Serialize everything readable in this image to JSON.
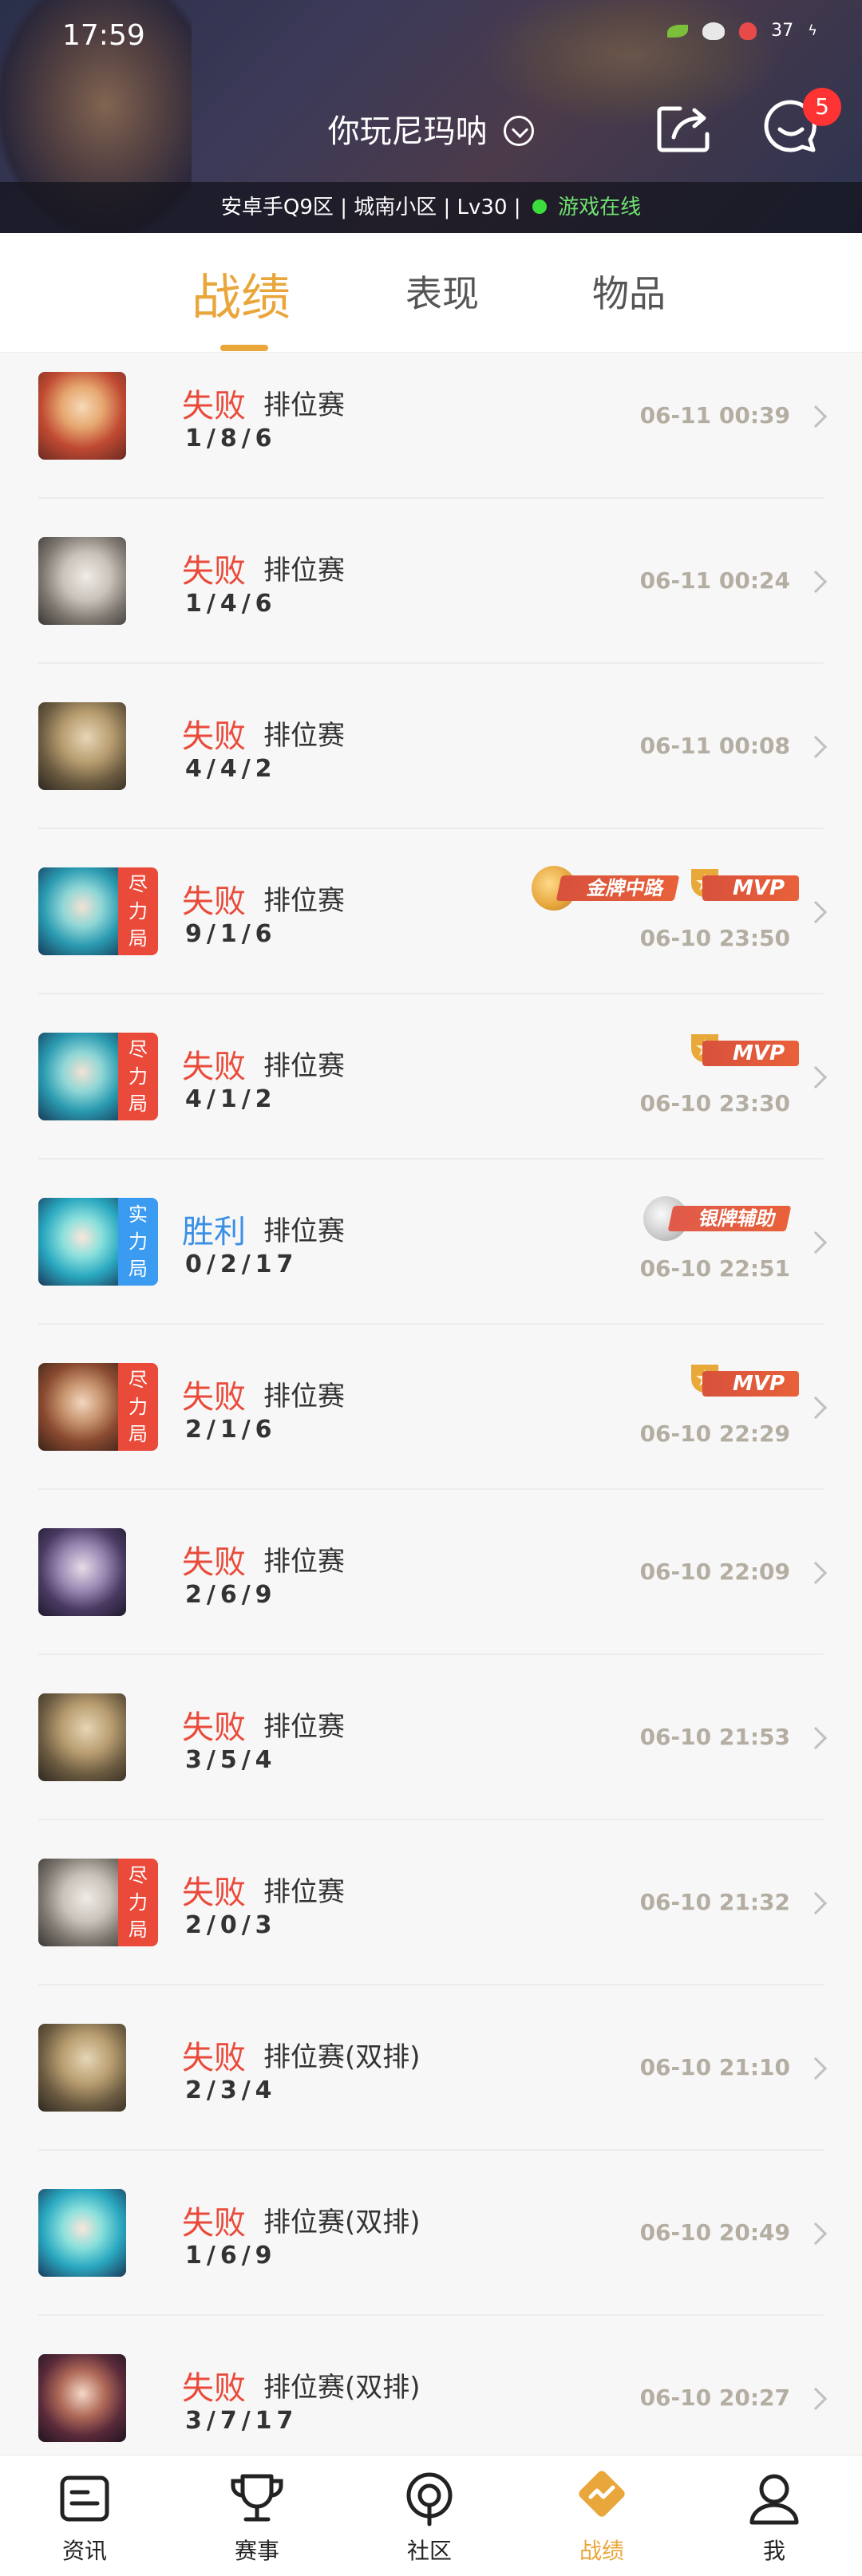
{
  "status_bar": {
    "time": "17:59",
    "battery": "37"
  },
  "header": {
    "player_name": "你玩尼玛呐",
    "notification_count": "5",
    "server": "安卓手Q9区",
    "region": "城南小区",
    "level": "Lv30",
    "separator": "|",
    "online_status": "游戏在线"
  },
  "tabs": [
    {
      "label": "战绩",
      "active": true
    },
    {
      "label": "表现",
      "active": false
    },
    {
      "label": "物品",
      "active": false
    }
  ],
  "matches": [
    {
      "result": "失败",
      "mode": "排位赛",
      "kda": "1/8/6",
      "time": "06-11 00:39",
      "tag": "",
      "avatar": "hero-girl-red",
      "badges": []
    },
    {
      "result": "失败",
      "mode": "排位赛",
      "kda": "1/4/6",
      "time": "06-11 00:24",
      "tag": "",
      "avatar": "hero-old-sage",
      "badges": []
    },
    {
      "result": "失败",
      "mode": "排位赛",
      "kda": "4/4/2",
      "time": "06-11 00:08",
      "tag": "",
      "avatar": "hero-blonde",
      "badges": []
    },
    {
      "result": "失败",
      "mode": "排位赛",
      "kda": "9/1/6",
      "time": "06-10 23:50",
      "tag": "尽力局",
      "avatar": "hero-teal-hair",
      "badges": [
        "金牌中路",
        "MVP"
      ]
    },
    {
      "result": "失败",
      "mode": "排位赛",
      "kda": "4/1/2",
      "time": "06-10 23:30",
      "tag": "尽力局",
      "avatar": "hero-teal-hair",
      "badges": [
        "MVP"
      ]
    },
    {
      "result": "胜利",
      "mode": "排位赛",
      "kda": "0/2/17",
      "time": "06-10 22:51",
      "tag": "实力局",
      "avatar": "hero-fairy",
      "badges": [
        "银牌辅助"
      ]
    },
    {
      "result": "失败",
      "mode": "排位赛",
      "kda": "2/1/6",
      "time": "06-10 22:29",
      "tag": "尽力局",
      "avatar": "hero-eyepatch",
      "badges": [
        "MVP"
      ]
    },
    {
      "result": "失败",
      "mode": "排位赛",
      "kda": "2/6/9",
      "time": "06-10 22:09",
      "tag": "",
      "avatar": "hero-dark-hair",
      "badges": []
    },
    {
      "result": "失败",
      "mode": "排位赛",
      "kda": "3/5/4",
      "time": "06-10 21:53",
      "tag": "",
      "avatar": "hero-blonde",
      "badges": []
    },
    {
      "result": "失败",
      "mode": "排位赛",
      "kda": "2/0/3",
      "time": "06-10 21:32",
      "tag": "尽力局",
      "avatar": "hero-old-sage",
      "badges": []
    },
    {
      "result": "失败",
      "mode": "排位赛(双排)",
      "kda": "2/3/4",
      "time": "06-10 21:10",
      "tag": "",
      "avatar": "hero-blonde",
      "badges": []
    },
    {
      "result": "失败",
      "mode": "排位赛(双排)",
      "kda": "1/6/9",
      "time": "06-10 20:49",
      "tag": "",
      "avatar": "hero-fairy",
      "badges": []
    },
    {
      "result": "失败",
      "mode": "排位赛(双排)",
      "kda": "3/7/17",
      "time": "06-10 20:27",
      "tag": "",
      "avatar": "hero-crowned",
      "badges": []
    }
  ],
  "bottom_nav": [
    {
      "label": "资讯",
      "icon": "news-icon",
      "active": false
    },
    {
      "label": "赛事",
      "icon": "trophy-icon",
      "active": false
    },
    {
      "label": "社区",
      "icon": "community-icon",
      "active": false
    },
    {
      "label": "战绩",
      "icon": "stats-icon",
      "active": true
    },
    {
      "label": "我",
      "icon": "profile-icon",
      "active": false
    }
  ],
  "colors": {
    "accent": "#e9a63a",
    "lose": "#ea4a3a",
    "win": "#3a8fe6",
    "online": "#3ddc3d"
  }
}
